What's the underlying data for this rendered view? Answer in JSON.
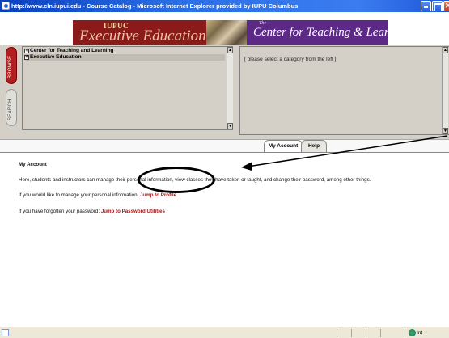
{
  "window": {
    "title": "http://www.cln.iupui.edu - Course Catalog - Microsoft Internet Explorer provided by IUPU Columbus"
  },
  "banner": {
    "left_subtitle": "IUPUC",
    "left_title": "Executive Education",
    "right_prefix": "The",
    "right_title": "Center for Teaching & Learning"
  },
  "sidetabs": {
    "browse": "BROWSE",
    "search": "SEARCH"
  },
  "categories": [
    {
      "label": "Center for Teaching and Learning"
    },
    {
      "label": "Executive Education"
    }
  ],
  "right_frame": {
    "message": "[ please select a category from the left ]"
  },
  "tabs": [
    {
      "label": "My Account",
      "active": true
    },
    {
      "label": "Help",
      "active": false
    }
  ],
  "content": {
    "title": "My Account",
    "description": "Here, students and instructors can manage their personal information, view classes they have taken or taught, and change their password, among other things.",
    "profile_prompt": "If you would like to manage your personal information:",
    "profile_link": "Jump to Profile",
    "password_prompt": "If you have forgotten your password:",
    "password_link": "Jump to Password Utilities"
  },
  "statusbar": {
    "zone": "Int"
  },
  "colors": {
    "titlebar": "#2a6fe6",
    "banner_left": "#8b1a1a",
    "banner_right": "#5c2a86",
    "link": "#a01818",
    "browse_tab": "#b02020"
  }
}
